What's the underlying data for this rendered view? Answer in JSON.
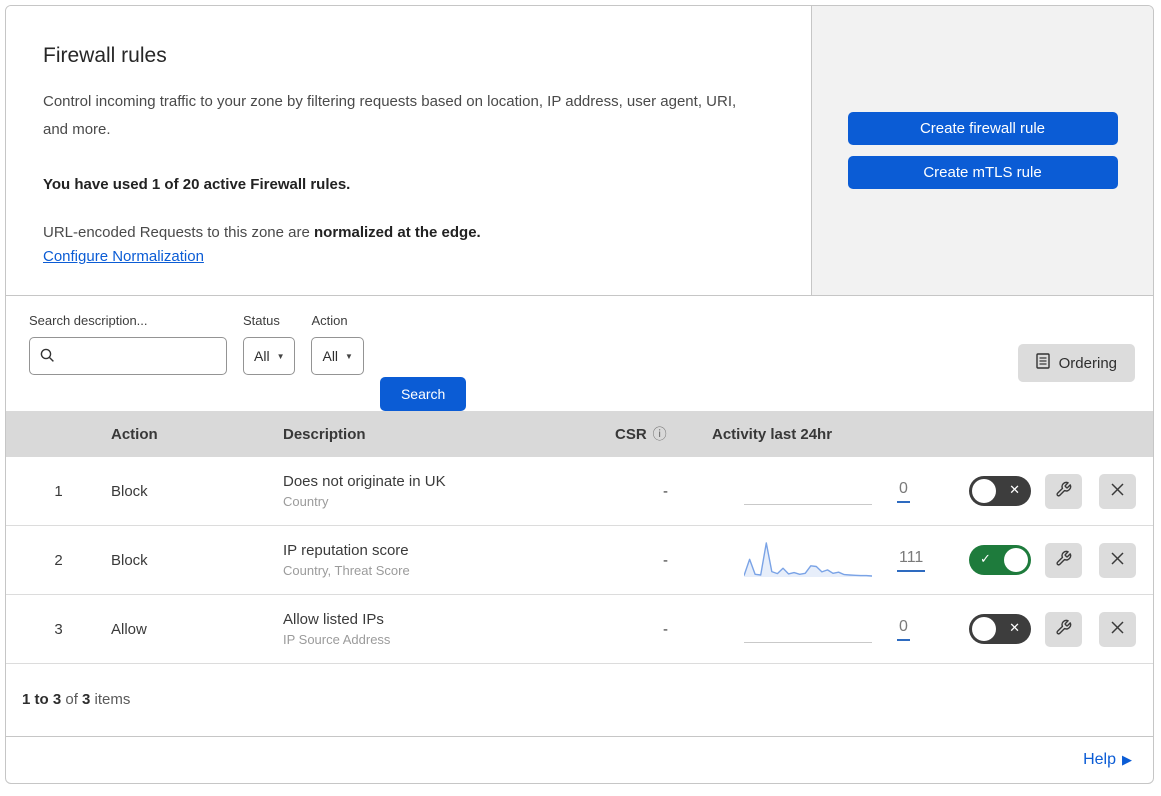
{
  "colors": {
    "accent_blue": "#0b5cd5",
    "toggle_on_green": "#1e7b3c",
    "toggle_off_gray": "#3d3d3d",
    "table_header_gray": "#d9d9d9",
    "panel_gray": "#f2f2f2",
    "sparkline_line": "#7aa3e6",
    "sparkline_fill": "rgba(122,163,230,0.18)",
    "count_underline": "#2e6bc0"
  },
  "icons": {
    "search": "magnifier",
    "ordering": "list-document",
    "csr_info_glyph": "ⓘ",
    "dropdown_caret_glyph": "▼",
    "toggle_check_glyph": "✓",
    "toggle_x_glyph": "✕",
    "help_arrow_glyph": "▶",
    "wrench": "wrench",
    "delete": "x-cross"
  },
  "intro": {
    "title": "Firewall rules",
    "description": "Control incoming traffic to your zone by filtering requests based on location, IP address, user agent, URI, and more.",
    "usage": "You have used 1 of 20 active Firewall rules.",
    "normalization_prefix": "URL-encoded Requests to this zone are ",
    "normalization_bold": "normalized at the edge.",
    "normalization_link": "Configure Normalization"
  },
  "actions_panel": {
    "create_firewall_label": "Create firewall rule",
    "create_mtls_label": "Create mTLS rule"
  },
  "filters": {
    "search_label": "Search description...",
    "search_value": "",
    "status_label": "Status",
    "status_value": "All",
    "action_label": "Action",
    "action_value": "All",
    "search_button": "Search",
    "ordering_button": "Ordering"
  },
  "table": {
    "headers": {
      "action": "Action",
      "description": "Description",
      "csr": "CSR",
      "activity": "Activity last 24hr"
    },
    "rows": [
      {
        "priority": "1",
        "action": "Block",
        "description": "Does not originate in UK",
        "criteria": "Country",
        "csr": "-",
        "count": "0",
        "enabled": false
      },
      {
        "priority": "2",
        "action": "Block",
        "description": "IP reputation score",
        "criteria": "Country, Threat Score",
        "csr": "-",
        "count": "111",
        "enabled": true
      },
      {
        "priority": "3",
        "action": "Allow",
        "description": "Allow listed IPs",
        "criteria": "IP Source Address",
        "csr": "-",
        "count": "0",
        "enabled": false
      }
    ]
  },
  "footer": {
    "range_bold": "1 to 3",
    "of_text": " of ",
    "total_bold": "3",
    "items_text": " items"
  },
  "help": {
    "label": "Help"
  },
  "chart_data": {
    "type": "line",
    "context": "Firewall rule 2 sparkline — Activity last 24hr, total 111 events",
    "x_label": "last 24 hours (time buckets, left = oldest)",
    "y_label": "relative event volume (unlabeled axis)",
    "values": [
      4,
      52,
      8,
      6,
      100,
      16,
      10,
      26,
      9,
      13,
      8,
      11,
      33,
      31,
      15,
      21,
      11,
      14,
      7,
      6,
      5,
      4,
      4,
      3
    ],
    "ylim": [
      0,
      100
    ],
    "grid": false,
    "legend": false
  }
}
